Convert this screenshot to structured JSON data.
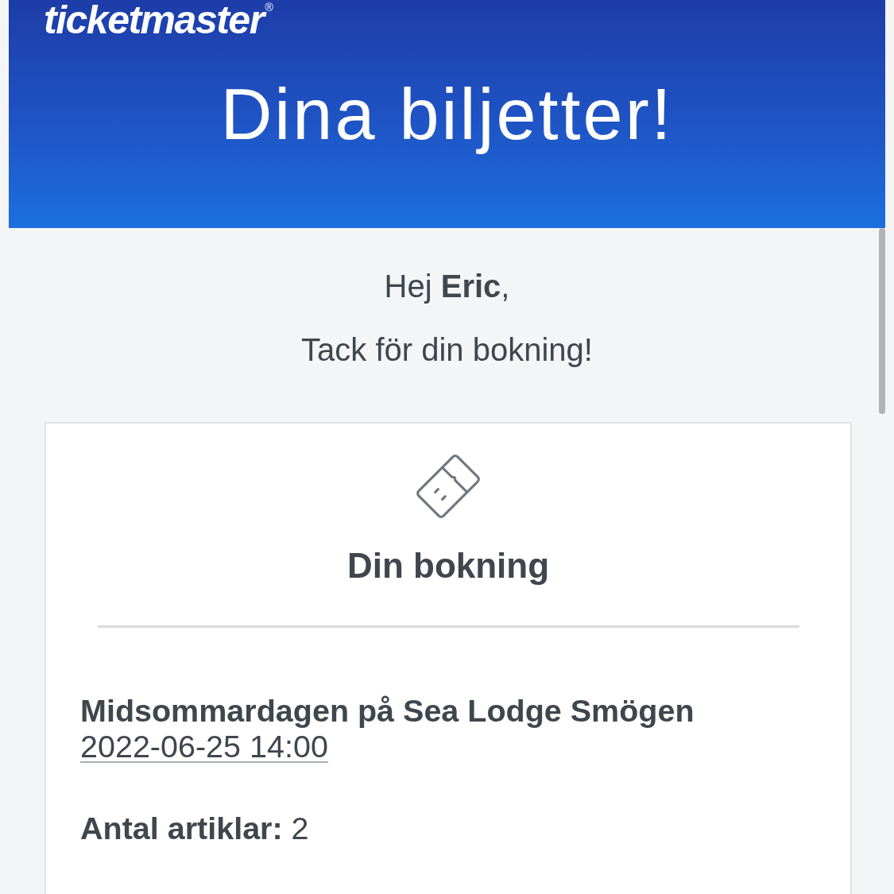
{
  "header": {
    "logo": "ticketmaster$^{®}$",
    "title": "Dina biljetter!"
  },
  "greeting": {
    "salutation": "Hej **Eric**,",
    "message": "Tack för din bokning!"
  },
  "booking_card": {
    "heading": "Din bokning",
    "event": {
      "name": "Midsommardagen på Sea Lodge Smögen",
      "date_time": "2022-06-25 14:00"
    },
    "item_count": "**Antal artiklar:** 2"
  }
}
